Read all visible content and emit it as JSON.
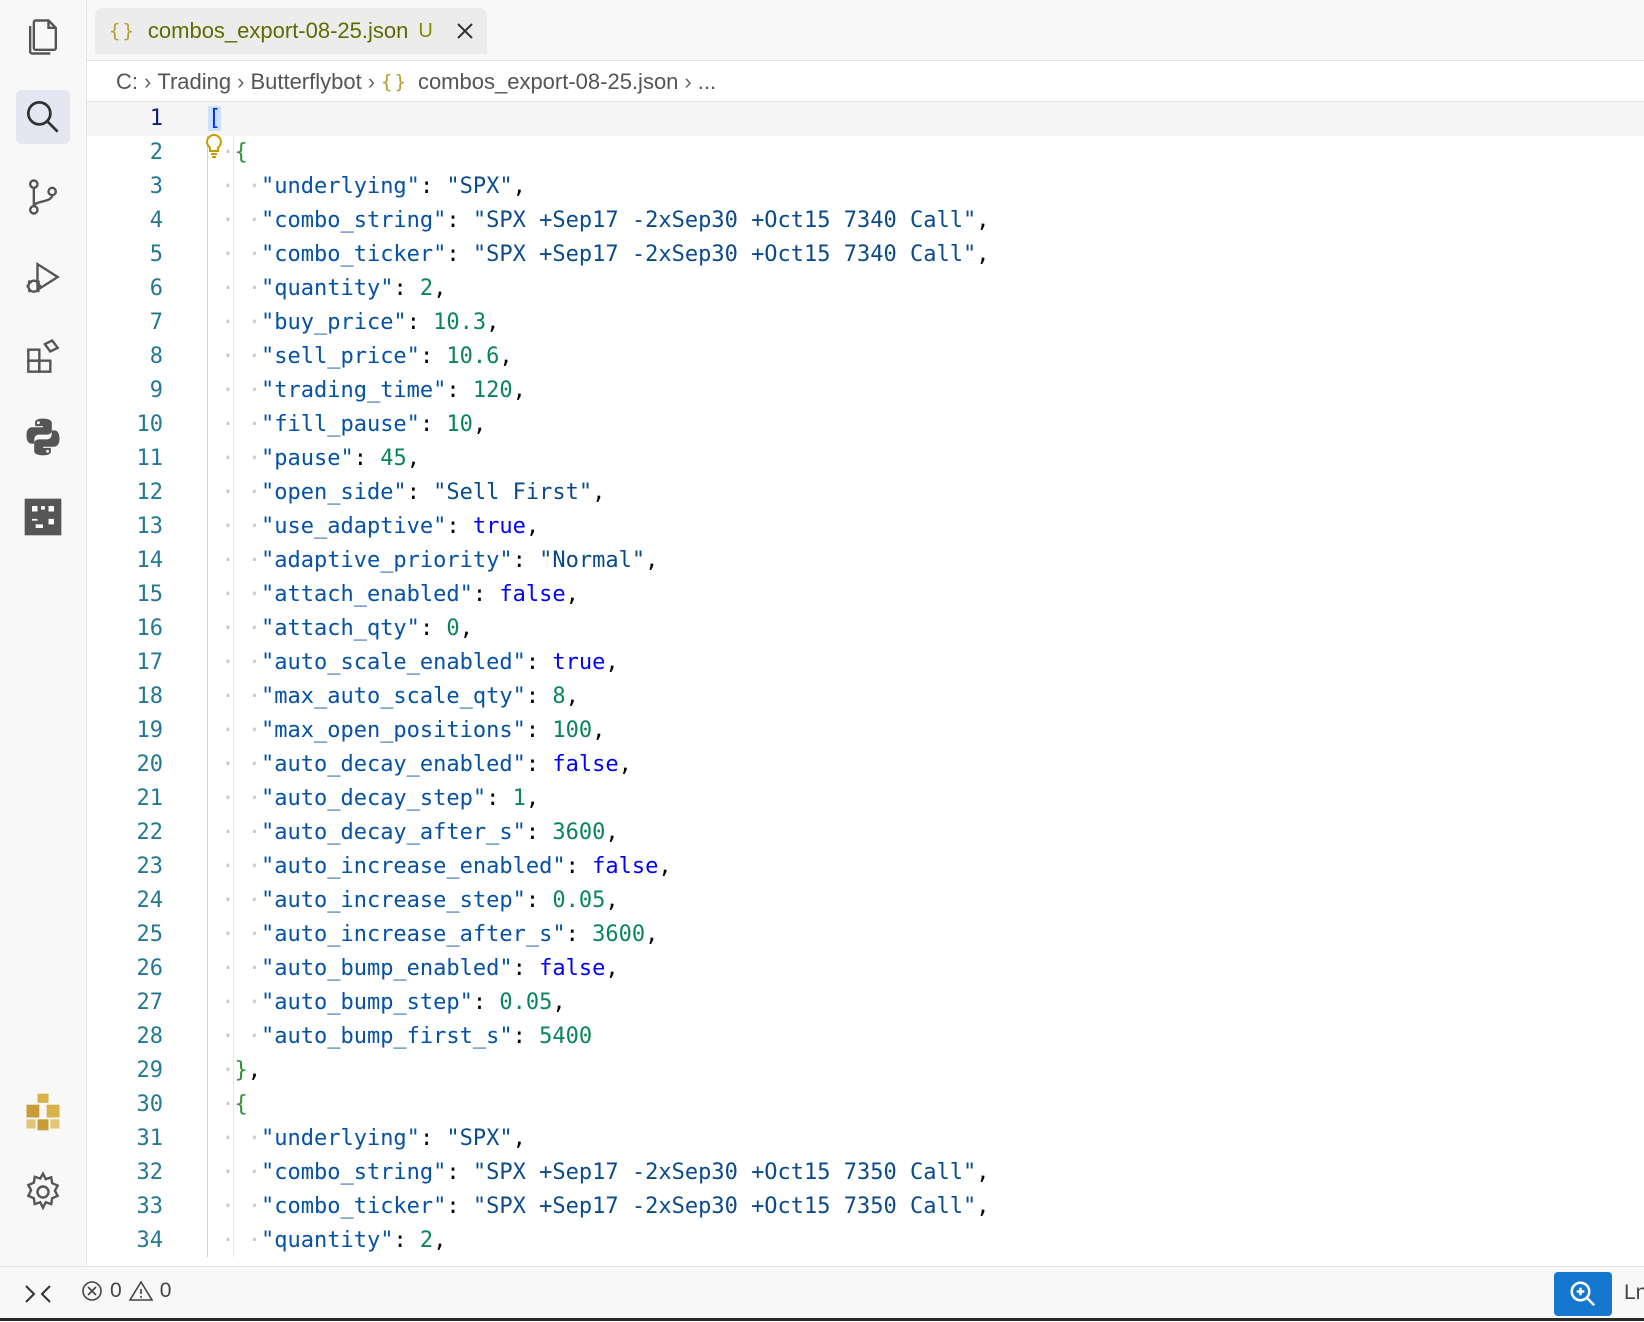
{
  "tab": {
    "label": "combos_export-08-25.json",
    "badge": "U",
    "icon": "{}"
  },
  "breadcrumb": {
    "items": [
      "C:",
      "Trading",
      "Butterflybot",
      "combos_export-08-25.json",
      "..."
    ],
    "file_icon": "{}"
  },
  "activity_bar": [
    "explorer-icon",
    "search-icon",
    "source-control-icon",
    "run-debug-icon",
    "extensions-icon",
    "python-icon",
    "jupyter-icon",
    "account-icon",
    "settings-icon"
  ],
  "status": {
    "errors": "0",
    "warnings": "0",
    "position_label": "Ln"
  },
  "editor": {
    "lines": [
      {
        "n": "1",
        "tokens": [
          [
            "bk",
            "["
          ]
        ]
      },
      {
        "n": "2",
        "tokens": [
          [
            "br",
            "{"
          ]
        ]
      },
      {
        "n": "3",
        "tokens": [
          [
            "k",
            "\"underlying\""
          ],
          [
            "p",
            ":"
          ],
          [
            "s",
            " \"SPX\""
          ],
          [
            "p",
            ","
          ]
        ]
      },
      {
        "n": "4",
        "tokens": [
          [
            "k",
            "\"combo_string\""
          ],
          [
            "p",
            ":"
          ],
          [
            "s",
            " \"SPX +Sep17 -2xSep30 +Oct15 7340 Call\""
          ],
          [
            "p",
            ","
          ]
        ]
      },
      {
        "n": "5",
        "tokens": [
          [
            "k",
            "\"combo_ticker\""
          ],
          [
            "p",
            ":"
          ],
          [
            "s",
            " \"SPX +Sep17 -2xSep30 +Oct15 7340 Call\""
          ],
          [
            "p",
            ","
          ]
        ]
      },
      {
        "n": "6",
        "tokens": [
          [
            "k",
            "\"quantity\""
          ],
          [
            "p",
            ":"
          ],
          [
            "n",
            " 2"
          ],
          [
            "p",
            ","
          ]
        ]
      },
      {
        "n": "7",
        "tokens": [
          [
            "k",
            "\"buy_price\""
          ],
          [
            "p",
            ":"
          ],
          [
            "n",
            " 10.3"
          ],
          [
            "p",
            ","
          ]
        ]
      },
      {
        "n": "8",
        "tokens": [
          [
            "k",
            "\"sell_price\""
          ],
          [
            "p",
            ":"
          ],
          [
            "n",
            " 10.6"
          ],
          [
            "p",
            ","
          ]
        ]
      },
      {
        "n": "9",
        "tokens": [
          [
            "k",
            "\"trading_time\""
          ],
          [
            "p",
            ":"
          ],
          [
            "n",
            " 120"
          ],
          [
            "p",
            ","
          ]
        ]
      },
      {
        "n": "10",
        "tokens": [
          [
            "k",
            "\"fill_pause\""
          ],
          [
            "p",
            ":"
          ],
          [
            "n",
            " 10"
          ],
          [
            "p",
            ","
          ]
        ]
      },
      {
        "n": "11",
        "tokens": [
          [
            "k",
            "\"pause\""
          ],
          [
            "p",
            ":"
          ],
          [
            "n",
            " 45"
          ],
          [
            "p",
            ","
          ]
        ]
      },
      {
        "n": "12",
        "tokens": [
          [
            "k",
            "\"open_side\""
          ],
          [
            "p",
            ":"
          ],
          [
            "s",
            " \"Sell First\""
          ],
          [
            "p",
            ","
          ]
        ]
      },
      {
        "n": "13",
        "tokens": [
          [
            "k",
            "\"use_adaptive\""
          ],
          [
            "p",
            ":"
          ],
          [
            "b",
            " true"
          ],
          [
            "p",
            ","
          ]
        ]
      },
      {
        "n": "14",
        "tokens": [
          [
            "k",
            "\"adaptive_priority\""
          ],
          [
            "p",
            ":"
          ],
          [
            "s",
            " \"Normal\""
          ],
          [
            "p",
            ","
          ]
        ]
      },
      {
        "n": "15",
        "tokens": [
          [
            "k",
            "\"attach_enabled\""
          ],
          [
            "p",
            ":"
          ],
          [
            "b",
            " false"
          ],
          [
            "p",
            ","
          ]
        ]
      },
      {
        "n": "16",
        "tokens": [
          [
            "k",
            "\"attach_qty\""
          ],
          [
            "p",
            ":"
          ],
          [
            "n",
            " 0"
          ],
          [
            "p",
            ","
          ]
        ]
      },
      {
        "n": "17",
        "tokens": [
          [
            "k",
            "\"auto_scale_enabled\""
          ],
          [
            "p",
            ":"
          ],
          [
            "b",
            " true"
          ],
          [
            "p",
            ","
          ]
        ]
      },
      {
        "n": "18",
        "tokens": [
          [
            "k",
            "\"max_auto_scale_qty\""
          ],
          [
            "p",
            ":"
          ],
          [
            "n",
            " 8"
          ],
          [
            "p",
            ","
          ]
        ]
      },
      {
        "n": "19",
        "tokens": [
          [
            "k",
            "\"max_open_positions\""
          ],
          [
            "p",
            ":"
          ],
          [
            "n",
            " 100"
          ],
          [
            "p",
            ","
          ]
        ]
      },
      {
        "n": "20",
        "tokens": [
          [
            "k",
            "\"auto_decay_enabled\""
          ],
          [
            "p",
            ":"
          ],
          [
            "b",
            " false"
          ],
          [
            "p",
            ","
          ]
        ]
      },
      {
        "n": "21",
        "tokens": [
          [
            "k",
            "\"auto_decay_step\""
          ],
          [
            "p",
            ":"
          ],
          [
            "n",
            " 1"
          ],
          [
            "p",
            ","
          ]
        ]
      },
      {
        "n": "22",
        "tokens": [
          [
            "k",
            "\"auto_decay_after_s\""
          ],
          [
            "p",
            ":"
          ],
          [
            "n",
            " 3600"
          ],
          [
            "p",
            ","
          ]
        ]
      },
      {
        "n": "23",
        "tokens": [
          [
            "k",
            "\"auto_increase_enabled\""
          ],
          [
            "p",
            ":"
          ],
          [
            "b",
            " false"
          ],
          [
            "p",
            ","
          ]
        ]
      },
      {
        "n": "24",
        "tokens": [
          [
            "k",
            "\"auto_increase_step\""
          ],
          [
            "p",
            ":"
          ],
          [
            "n",
            " 0.05"
          ],
          [
            "p",
            ","
          ]
        ]
      },
      {
        "n": "25",
        "tokens": [
          [
            "k",
            "\"auto_increase_after_s\""
          ],
          [
            "p",
            ":"
          ],
          [
            "n",
            " 3600"
          ],
          [
            "p",
            ","
          ]
        ]
      },
      {
        "n": "26",
        "tokens": [
          [
            "k",
            "\"auto_bump_enabled\""
          ],
          [
            "p",
            ":"
          ],
          [
            "b",
            " false"
          ],
          [
            "p",
            ","
          ]
        ]
      },
      {
        "n": "27",
        "tokens": [
          [
            "k",
            "\"auto_bump_step\""
          ],
          [
            "p",
            ":"
          ],
          [
            "n",
            " 0.05"
          ],
          [
            "p",
            ","
          ]
        ]
      },
      {
        "n": "28",
        "tokens": [
          [
            "k",
            "\"auto_bump_first_s\""
          ],
          [
            "p",
            ":"
          ],
          [
            "n",
            " 5400"
          ]
        ]
      },
      {
        "n": "29",
        "tokens": [
          [
            "br",
            "}"
          ],
          [
            "p",
            ","
          ]
        ]
      },
      {
        "n": "30",
        "tokens": [
          [
            "br",
            "{"
          ]
        ]
      },
      {
        "n": "31",
        "tokens": [
          [
            "k",
            "\"underlying\""
          ],
          [
            "p",
            ":"
          ],
          [
            "s",
            " \"SPX\""
          ],
          [
            "p",
            ","
          ]
        ]
      },
      {
        "n": "32",
        "tokens": [
          [
            "k",
            "\"combo_string\""
          ],
          [
            "p",
            ":"
          ],
          [
            "s",
            " \"SPX +Sep17 -2xSep30 +Oct15 7350 Call\""
          ],
          [
            "p",
            ","
          ]
        ]
      },
      {
        "n": "33",
        "tokens": [
          [
            "k",
            "\"combo_ticker\""
          ],
          [
            "p",
            ":"
          ],
          [
            "s",
            " \"SPX +Sep17 -2xSep30 +Oct15 7350 Call\""
          ],
          [
            "p",
            ","
          ]
        ]
      },
      {
        "n": "34",
        "tokens": [
          [
            "k",
            "\"quantity\""
          ],
          [
            "p",
            ":"
          ],
          [
            "n",
            " 2"
          ],
          [
            "p",
            ","
          ]
        ]
      }
    ]
  }
}
